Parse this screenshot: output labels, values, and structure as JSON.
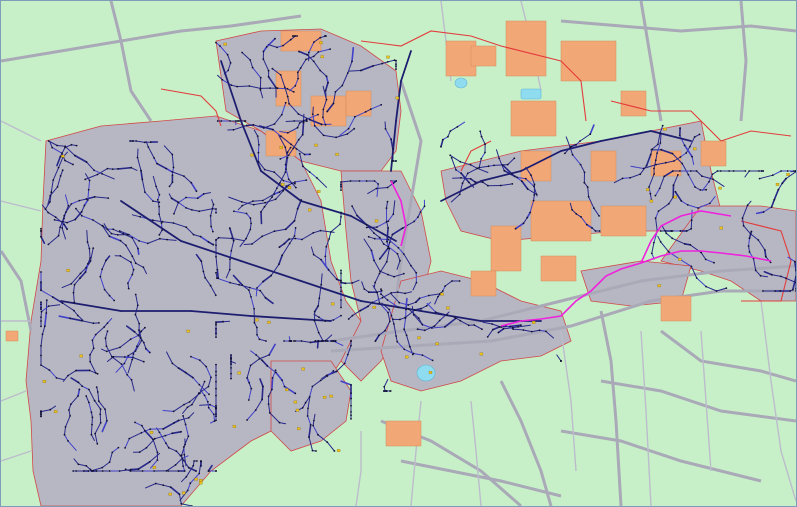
{
  "map": {
    "colors": {
      "land": "#c8f0c8",
      "urban": "#b7b7c3",
      "road": "#a9a9b8",
      "industrial": "#f2a876",
      "water": "#8fdcf0",
      "pipe_primary": "#27278a",
      "pipe_secondary": "#4040c8",
      "boundary": "#e23b3b",
      "route_highlight": "#ee22dd",
      "node": "#101030",
      "marker": "#e8c020"
    },
    "layers": [
      "land-background",
      "urban-area",
      "road-network",
      "industrial-parcels",
      "water-bodies",
      "district-boundary",
      "pipe-network",
      "network-nodes",
      "highlighted-route",
      "asset-markers"
    ],
    "labels_note_visible": false
  }
}
